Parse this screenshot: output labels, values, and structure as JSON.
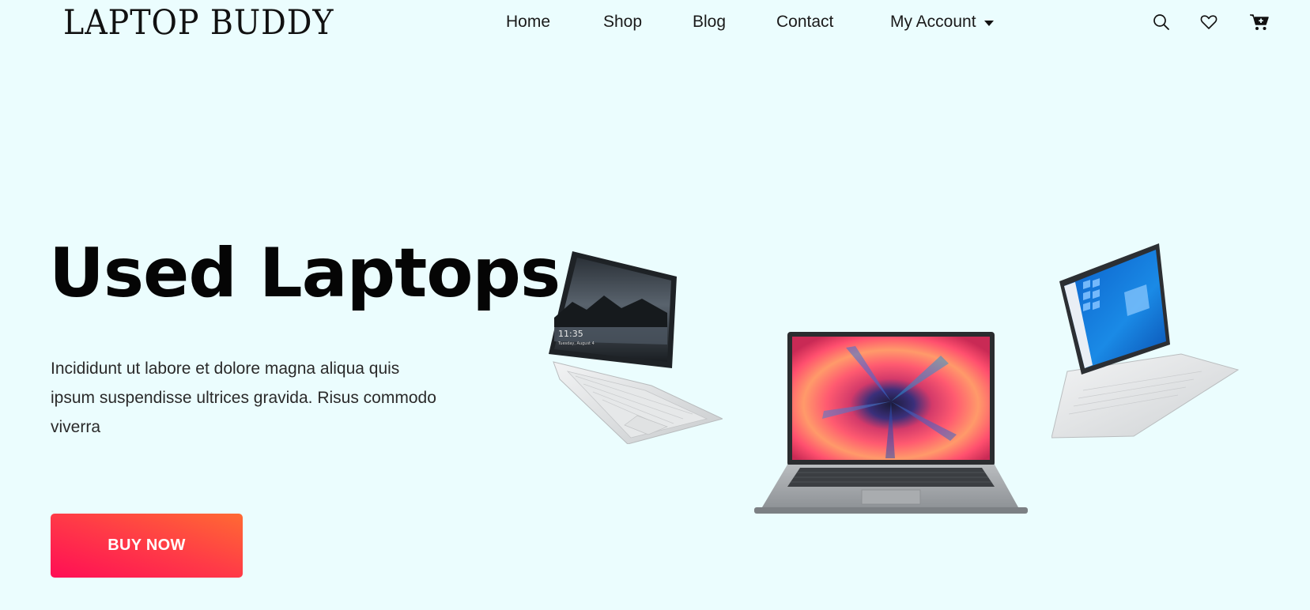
{
  "brand": {
    "logo_text": "LAPTOP BUDDY"
  },
  "nav": {
    "items": [
      {
        "label": "Home"
      },
      {
        "label": "Shop"
      },
      {
        "label": "Blog"
      },
      {
        "label": "Contact"
      },
      {
        "label": "My Account"
      }
    ]
  },
  "header_icons": [
    "search-icon",
    "heart-icon",
    "cart-icon"
  ],
  "hero": {
    "title": "Used Laptops",
    "description": "Incididunt ut labore et dolore magna aliqua quis ipsum suspendisse ultrices gravida. Risus commodo viverra",
    "cta_label": "BUY NOW",
    "laptop_screen_time": "11:35",
    "laptop_screen_date": "Tuesday, August 4"
  },
  "colors": {
    "background": "#ebfdfe",
    "cta_gradient_start": "#ff0e55",
    "cta_gradient_end": "#ff6a33"
  }
}
